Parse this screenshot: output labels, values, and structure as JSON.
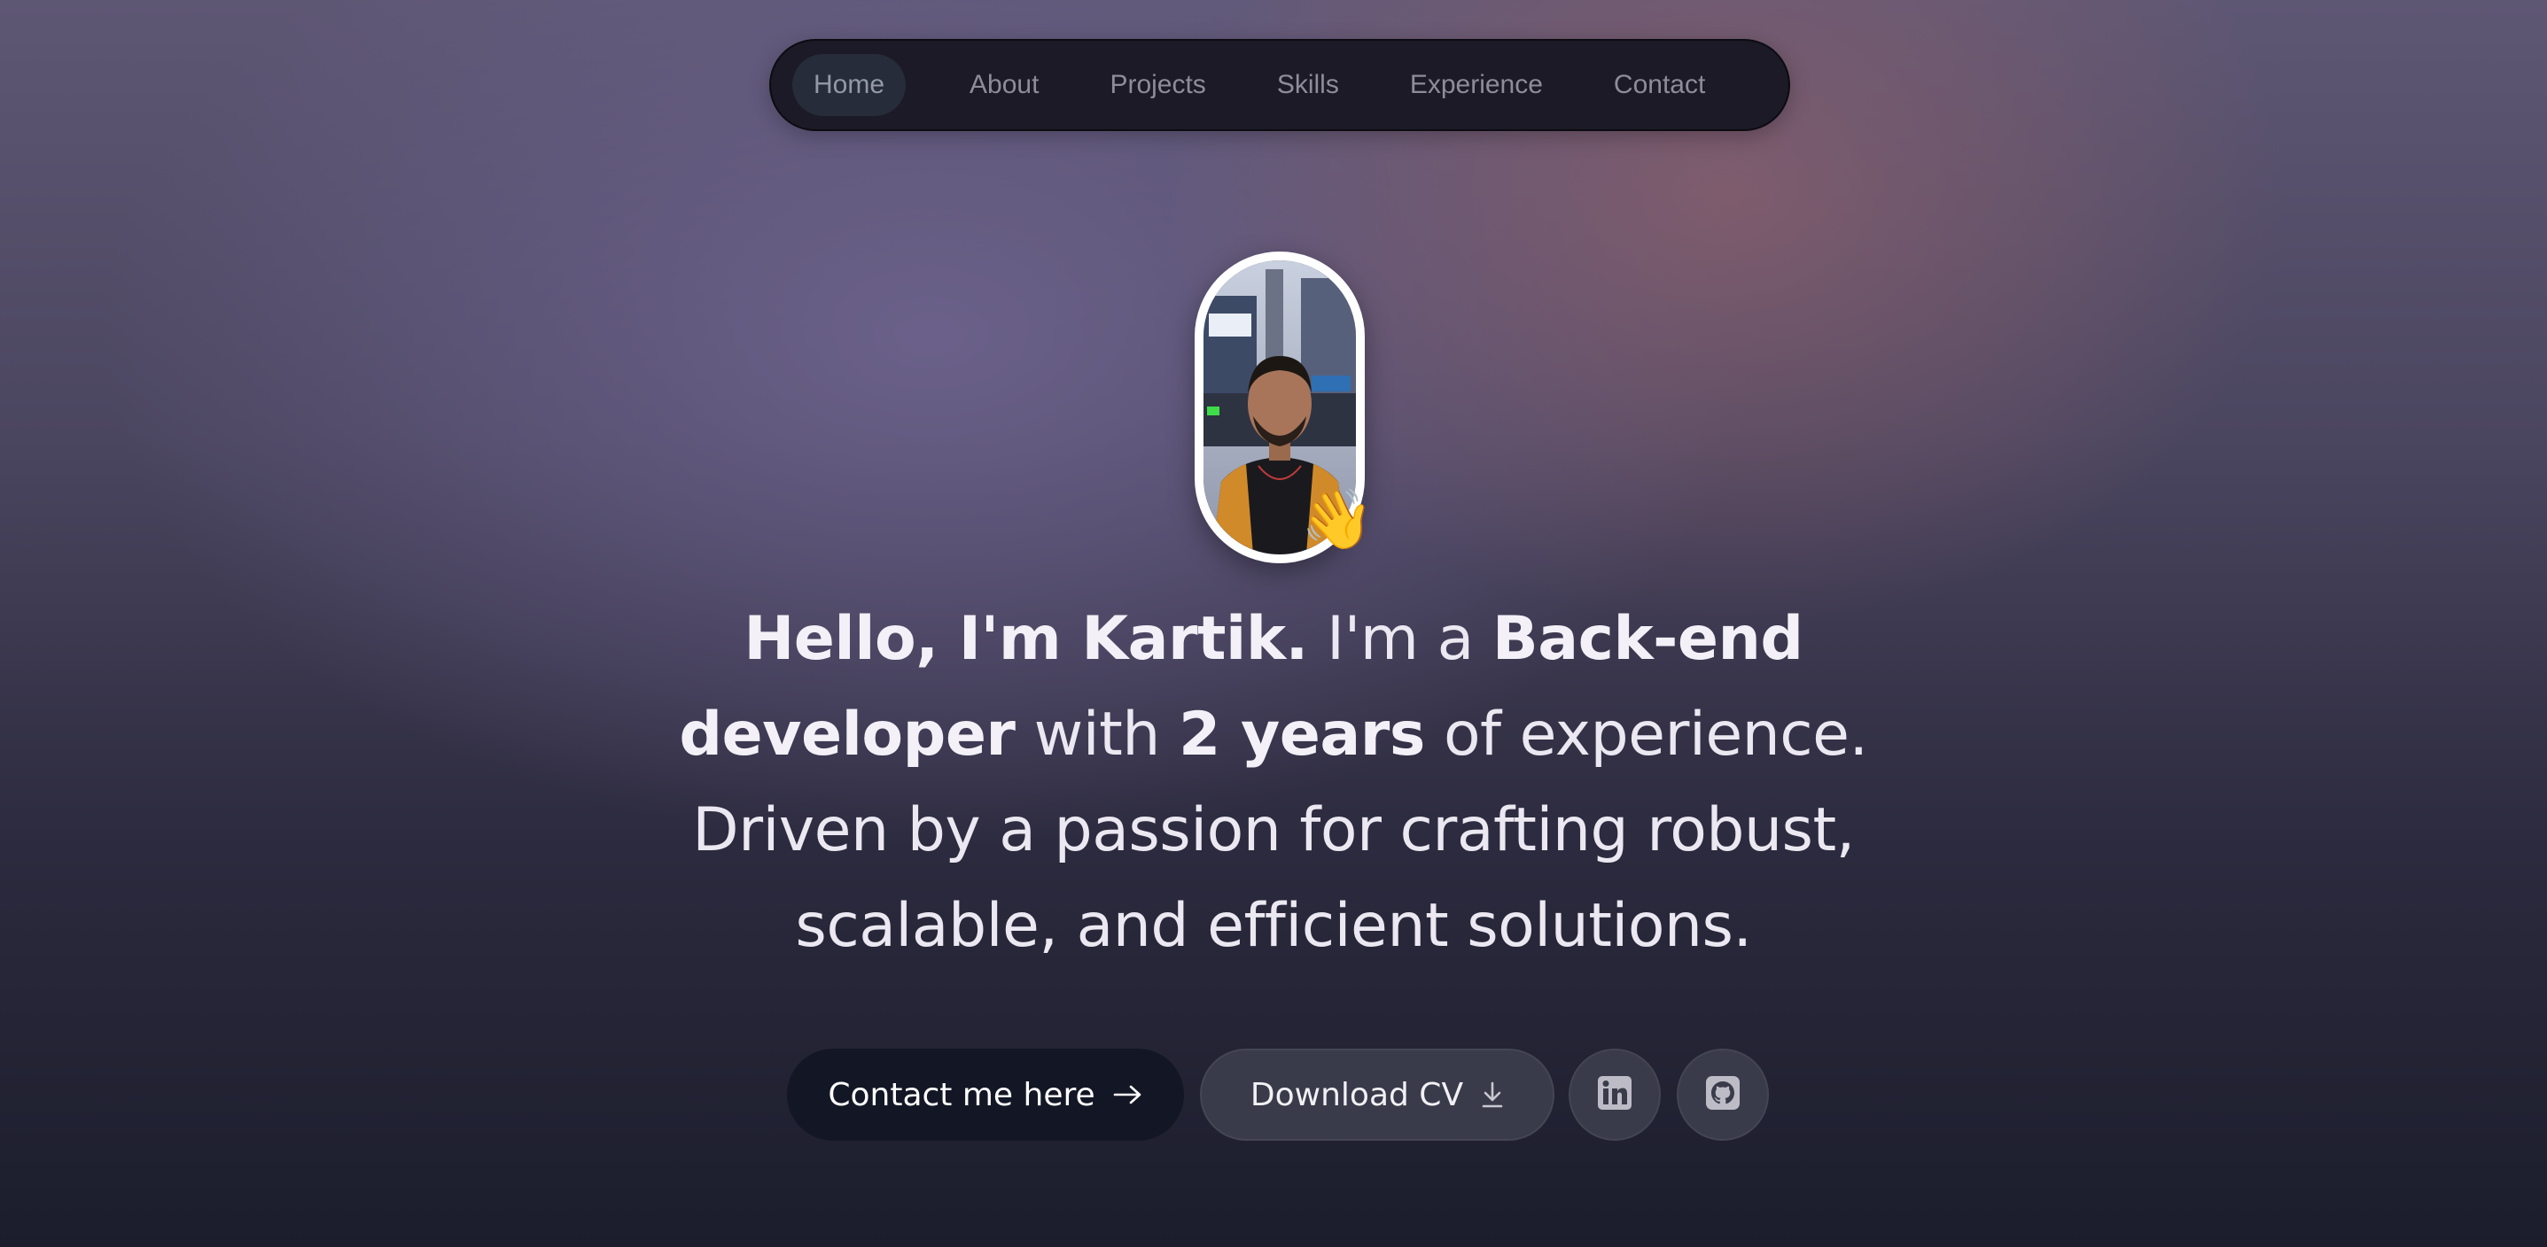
{
  "nav": {
    "items": [
      {
        "label": "Home"
      },
      {
        "label": "About"
      },
      {
        "label": "Projects"
      },
      {
        "label": "Skills"
      },
      {
        "label": "Experience"
      },
      {
        "label": "Contact"
      }
    ],
    "active_index": 0
  },
  "hero": {
    "intro": "Hello, I'm Kartik.",
    "role_prefix": " I'm a ",
    "role": "Back-end developer",
    "line2_prefix": " with ",
    "years": "2 years",
    "rest": " of experience. Driven by a passion for crafting robust, scalable, and efficient solutions.",
    "wave_emoji": "👋"
  },
  "buttons": {
    "contact_label": "Contact me here",
    "cv_label": "Download CV",
    "contact_icon": "arrow-right-icon",
    "cv_icon": "download-icon",
    "linkedin_icon": "linkedin-icon",
    "github_icon": "github-icon"
  },
  "colors": {
    "nav_bg": "#1b1a26",
    "primary_button": "#131725",
    "secondary_button": "#3a3b4a",
    "avatar_border": "#ffffff"
  }
}
